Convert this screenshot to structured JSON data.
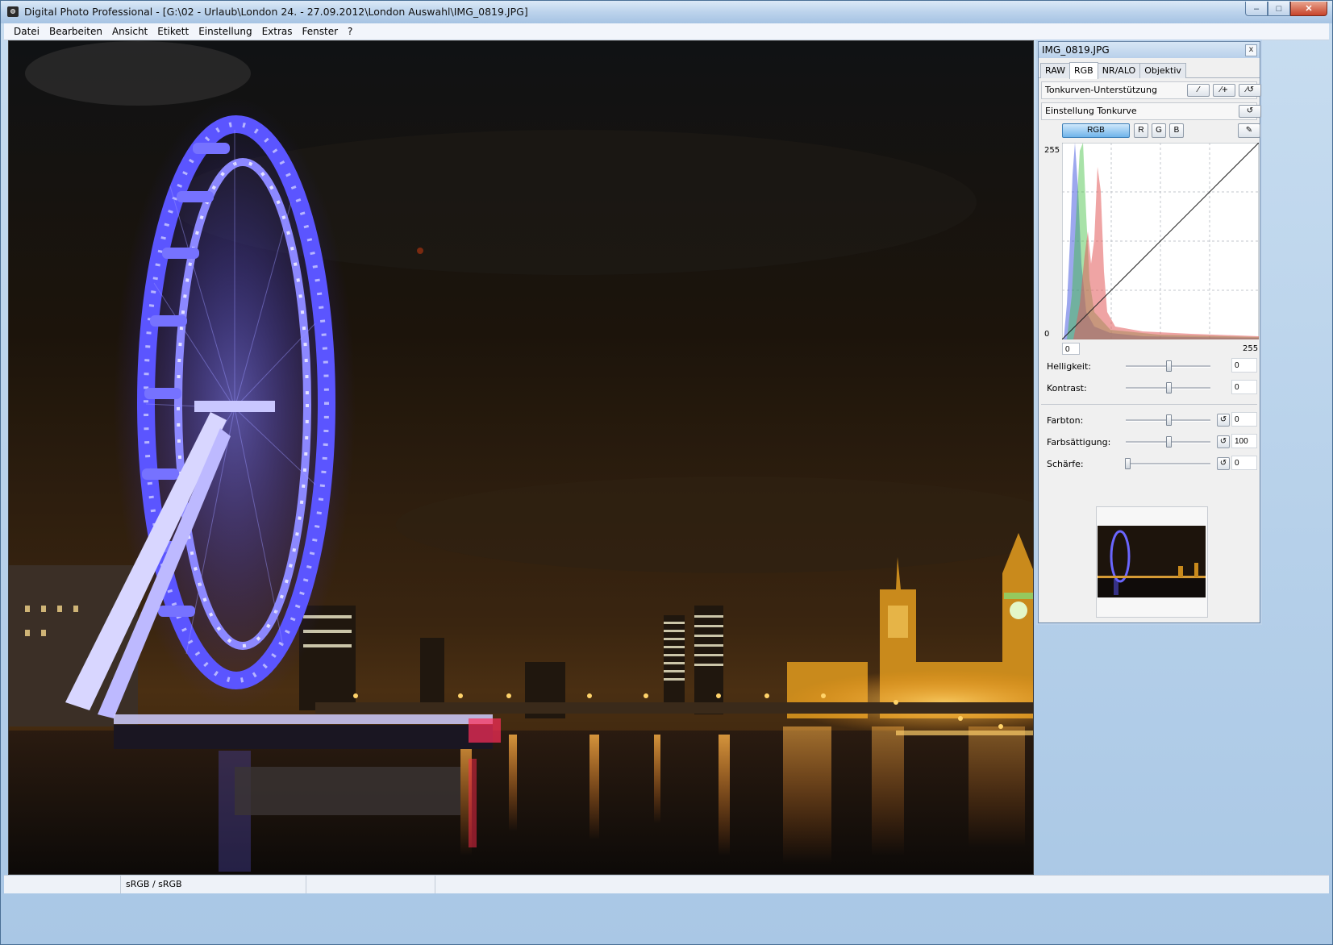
{
  "window": {
    "title": "Digital Photo Professional - [G:\\02 - Urlaub\\London 24. - 27.09.2012\\London Auswahl\\IMG_0819.JPG]",
    "minimize_glyph": "–",
    "maximize_glyph": "□",
    "close_glyph": "✕"
  },
  "menu": [
    "Datei",
    "Bearbeiten",
    "Ansicht",
    "Etikett",
    "Einstellung",
    "Extras",
    "Fenster",
    "?"
  ],
  "status": {
    "cell1": "",
    "cell2": "sRGB / sRGB",
    "cell3": "",
    "cell4": ""
  },
  "palette": {
    "title": "IMG_0819.JPG",
    "close_glyph": "x",
    "tabs": [
      "RAW",
      "RGB",
      "NR/ALO",
      "Objektiv"
    ],
    "active_tab": "RGB",
    "tone_curve_assist_label": "Tonkurven-Unterstützung",
    "tone_curve_adjust_label": "Einstellung Tonkurve",
    "channels": [
      "RGB",
      "R",
      "G",
      "B"
    ],
    "active_channel": "RGB",
    "curve": {
      "y_max_label": "255",
      "y_min_label": "0",
      "x_min_value": "0",
      "x_max_value": "255"
    },
    "sliders": [
      {
        "label": "Helligkeit:",
        "value": "0",
        "position": 0.5,
        "reset": false
      },
      {
        "label": "Kontrast:",
        "value": "0",
        "position": 0.5,
        "reset": false
      },
      {
        "label": "Farbton:",
        "value": "0",
        "position": 0.5,
        "reset": true
      },
      {
        "label": "Farbsättigung:",
        "value": "100",
        "position": 0.5,
        "reset": true
      },
      {
        "label": "Schärfe:",
        "value": "0",
        "position": 0.0,
        "reset": true
      }
    ]
  },
  "icons": {
    "app": "camera-icon",
    "curve_linear": "linear-curve-icon",
    "curve_add": "add-curve-icon",
    "curve_reset": "reset-curve-icon",
    "reset": "undo-icon",
    "eyedropper": "eyedropper-icon"
  },
  "colors": {
    "histogram_red": "#e25a5a",
    "histogram_green": "#3fbf3f",
    "histogram_blue": "#4a5ee0",
    "active_channel": "#6fb3ea",
    "wheel_glow": "#5b55ff"
  }
}
